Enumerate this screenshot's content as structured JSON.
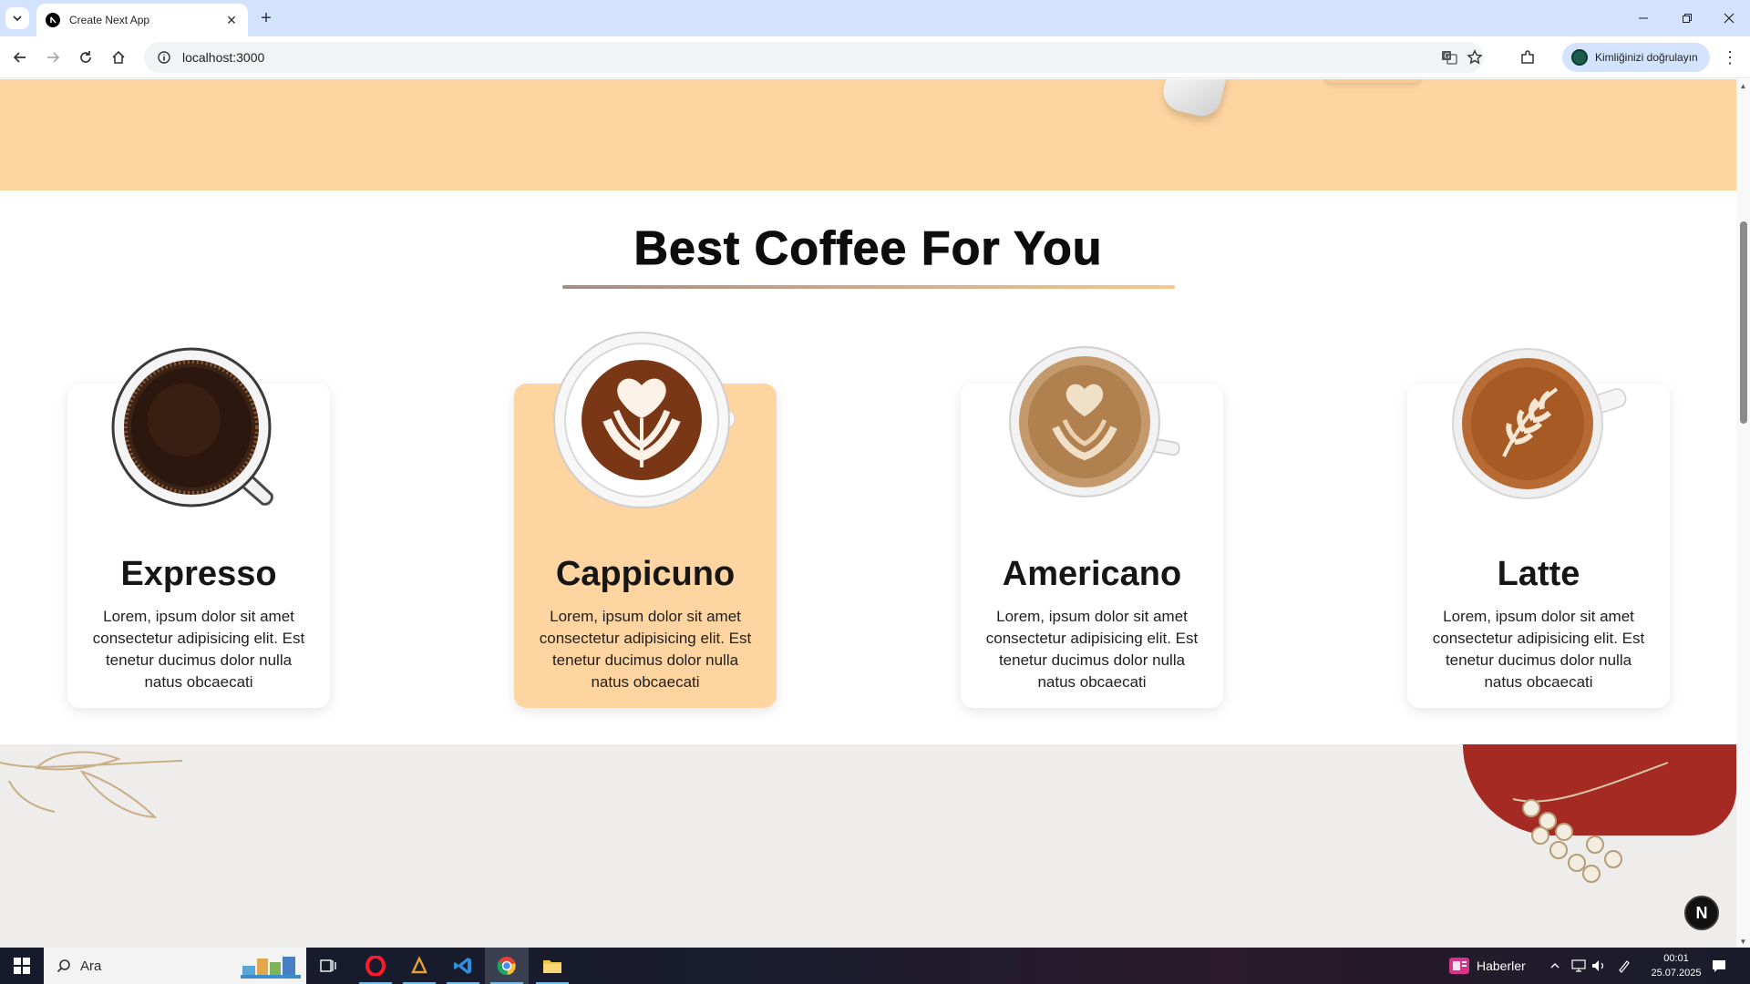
{
  "browser": {
    "tab_title": "Create Next App",
    "url": "localhost:3000",
    "profile_label": "Kimliğinizi doğrulayın"
  },
  "section": {
    "title": "Best Coffee For You"
  },
  "products": [
    {
      "name": "Expresso",
      "description": "Lorem, ipsum dolor sit amet consectetur adipisicing elit. Est tenetur ducimus dolor nulla natus obcaecati",
      "active": false
    },
    {
      "name": "Cappicuno",
      "description": "Lorem, ipsum dolor sit amet consectetur adipisicing elit. Est tenetur ducimus dolor nulla natus obcaecati",
      "active": true
    },
    {
      "name": "Americano",
      "description": "Lorem, ipsum dolor sit amet consectetur adipisicing elit. Est tenetur ducimus dolor nulla natus obcaecati",
      "active": false
    },
    {
      "name": "Latte",
      "description": "Lorem, ipsum dolor sit amet consectetur adipisicing elit. Est tenetur ducimus dolor nulla natus obcaecati",
      "active": false
    }
  ],
  "next_badge": "N",
  "taskbar": {
    "search_placeholder": "Ara",
    "news_label": "Haberler",
    "time": "00:01",
    "date": "25.07.2025"
  },
  "colors": {
    "accent_peach": "#fed4a0",
    "title_dark": "#0d0d0d",
    "chrome_blue": "#d3e3fd",
    "blob_red": "#a42a23"
  }
}
